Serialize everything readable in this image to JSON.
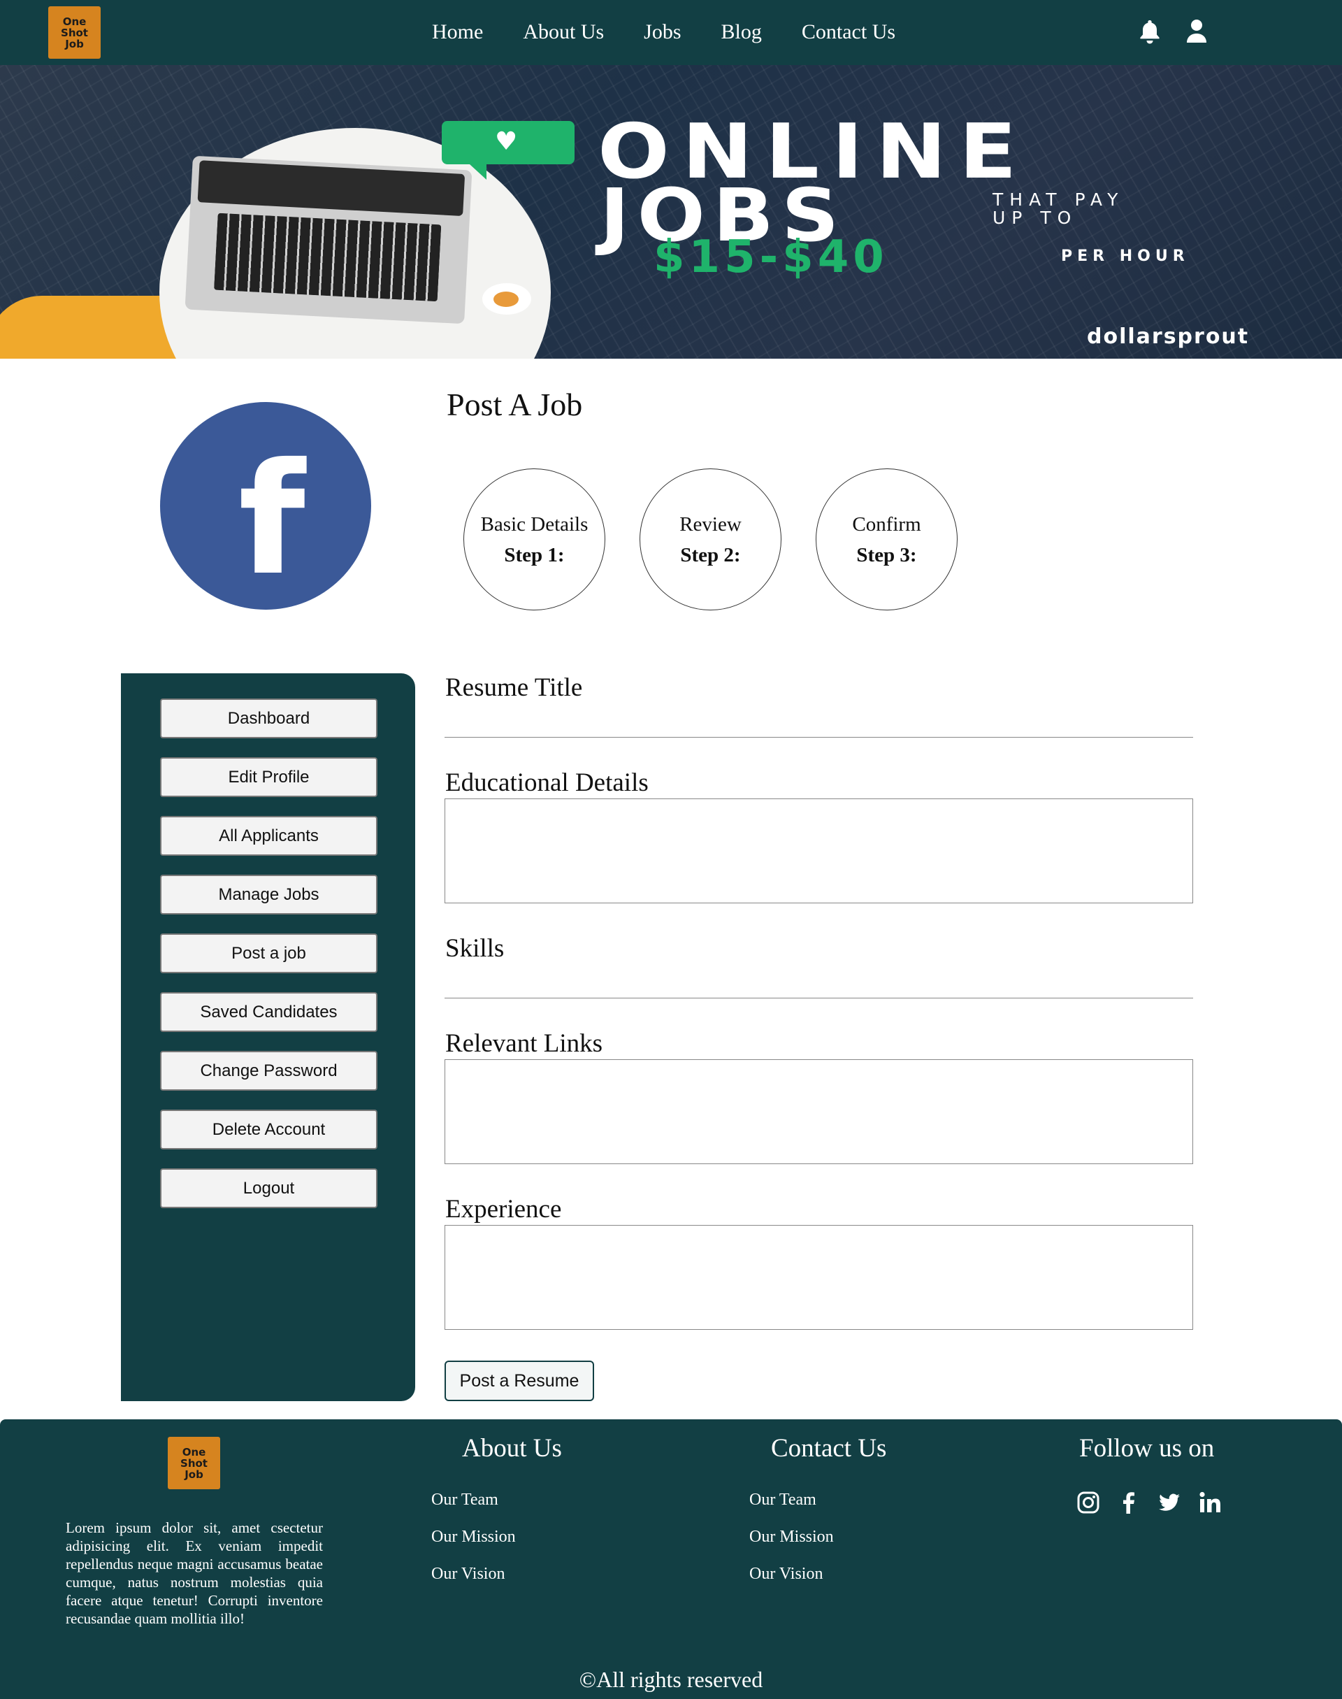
{
  "brand": {
    "logo_lines": [
      "One",
      "Shot",
      "Job"
    ]
  },
  "nav": {
    "links": [
      "Home",
      "About Us",
      "Jobs",
      "Blog",
      "Contact Us"
    ],
    "icons": [
      "bell-icon",
      "user-icon"
    ]
  },
  "banner": {
    "line1": "ONLINE",
    "line2": "JOBS",
    "line3a": "THAT PAY",
    "line3b": "UP TO",
    "price": "$15-$40",
    "per_hour": "PER HOUR",
    "brand": "dollarsprout",
    "heart_glyph": "♥"
  },
  "profile": {
    "icon": "facebook-icon",
    "glyph": "f",
    "color": "#3b5998"
  },
  "page": {
    "title": "Post A Job",
    "steps": [
      {
        "name": "Basic Details",
        "num": "Step 1:"
      },
      {
        "name": "Review",
        "num": "Step 2:"
      },
      {
        "name": "Confirm",
        "num": "Step 3:"
      }
    ]
  },
  "sidebar": {
    "items": [
      "Dashboard",
      "Edit Profile",
      "All Applicants",
      "Manage Jobs",
      "Post a job",
      "Saved Candidates",
      "Change Password",
      "Delete Account",
      "Logout"
    ]
  },
  "form": {
    "resume_title": "Resume Title",
    "educational_details": "Educational Details",
    "skills": "Skills",
    "relevant_links": "Relevant Links",
    "experience": "Experience",
    "submit": "Post a Resume"
  },
  "footer": {
    "description": "Lorem ipsum dolor sit, amet csectetur adipisicing elit. Ex veniam impedit repellendus neque magni accusamus beatae cumque, natus nostrum molestias quia facere atque tenetur! Corrupti inventore recusandae quam mollitia illo!",
    "about": {
      "heading": "About Us",
      "links": [
        "Our Team",
        "Our Mission",
        "Our Vision"
      ]
    },
    "contact": {
      "heading": "Contact Us",
      "links": [
        "Our Team",
        "Our Mission",
        "Our Vision"
      ]
    },
    "follow": {
      "heading": "Follow us on",
      "icons": [
        "instagram-icon",
        "facebook-icon",
        "twitter-icon",
        "linkedin-icon"
      ]
    },
    "copyright": "©All rights reserved"
  },
  "colors": {
    "primary": "#123f44",
    "logo": "#d6841f",
    "accent_green": "#1fb36b"
  }
}
